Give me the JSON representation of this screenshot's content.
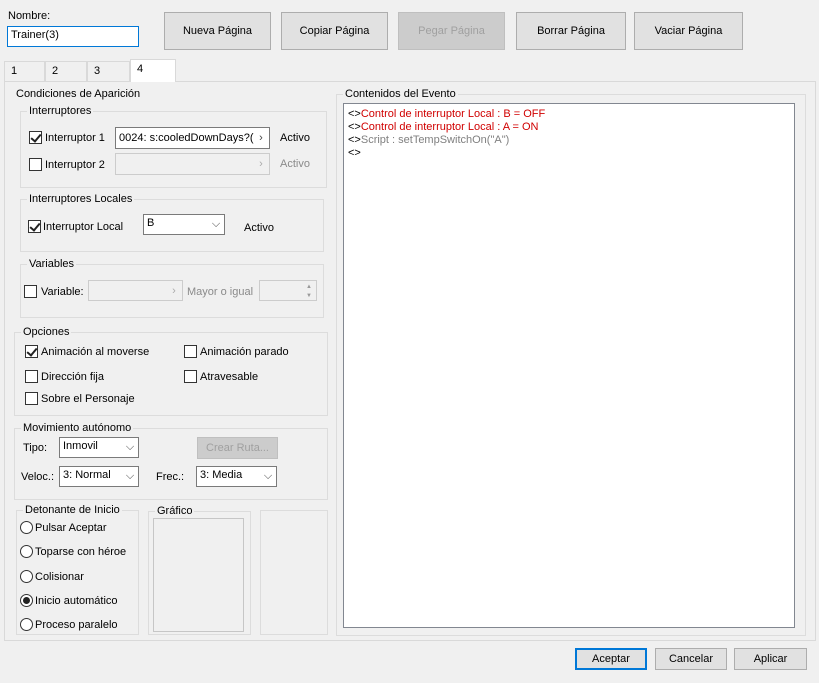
{
  "name": {
    "label": "Nombre:",
    "value": "Trainer(3)"
  },
  "toolbar": {
    "new_page": "Nueva Página",
    "copy_page": "Copiar Página",
    "paste_page": "Pegar Página",
    "delete_page": "Borrar Página",
    "clear_page": "Vaciar Página"
  },
  "tabs": [
    {
      "label": "1"
    },
    {
      "label": "2"
    },
    {
      "label": "3"
    },
    {
      "label": "4",
      "active": true
    }
  ],
  "conditions": {
    "title": "Condiciones de Aparición",
    "switches": {
      "title": "Interruptores",
      "switch1": {
        "label": "Interruptor 1",
        "checked": true,
        "value": "0024: s:cooledDownDays?(",
        "state": "Activo"
      },
      "switch2": {
        "label": "Interruptor 2",
        "checked": false,
        "value": "",
        "state": "Activo"
      }
    },
    "local_switches": {
      "title": "Interruptores Locales",
      "label": "Interruptor Local",
      "checked": true,
      "value": "B",
      "state": "Activo"
    },
    "variables": {
      "title": "Variables",
      "label": "Variable:",
      "checked": false,
      "value": "",
      "comparator": "Mayor o igual"
    }
  },
  "options": {
    "title": "Opciones",
    "walk_anim": {
      "label": "Animación al moverse",
      "checked": true
    },
    "step_anim": {
      "label": "Animación parado",
      "checked": false
    },
    "direction_fix": {
      "label": "Dirección fija",
      "checked": false
    },
    "through": {
      "label": "Atravesable",
      "checked": false
    },
    "always_on_top": {
      "label": "Sobre el Personaje",
      "checked": false
    }
  },
  "autonomous": {
    "title": "Movimiento autónomo",
    "type_label": "Tipo:",
    "type_value": "Inmovil",
    "route_button": "Crear Ruta...",
    "speed_label": "Veloc.:",
    "speed_value": "3: Normal",
    "freq_label": "Frec.:",
    "freq_value": "3: Media"
  },
  "trigger": {
    "title": "Detonante de Inicio",
    "options": [
      {
        "label": "Pulsar Aceptar",
        "checked": false
      },
      {
        "label": "Toparse con héroe",
        "checked": false
      },
      {
        "label": "Colisionar",
        "checked": false
      },
      {
        "label": "Inicio automático",
        "checked": true
      },
      {
        "label": "Proceso paralelo",
        "checked": false
      }
    ]
  },
  "graphic": {
    "title": "Gráfico"
  },
  "event_contents": {
    "title": "Contenidos del Evento",
    "lines": [
      {
        "marker": "<>",
        "text": "Control de interruptor Local : B = OFF",
        "color": "#d00000"
      },
      {
        "marker": "<>",
        "text": "Control de interruptor Local : A = ON",
        "color": "#d00000"
      },
      {
        "marker": "<>",
        "text": "Script : setTempSwitchOn(\"A\")",
        "color": "#808080"
      },
      {
        "marker": "<>",
        "text": "",
        "color": "#000000"
      }
    ]
  },
  "footer": {
    "ok": "Aceptar",
    "cancel": "Cancelar",
    "apply": "Aplicar"
  }
}
